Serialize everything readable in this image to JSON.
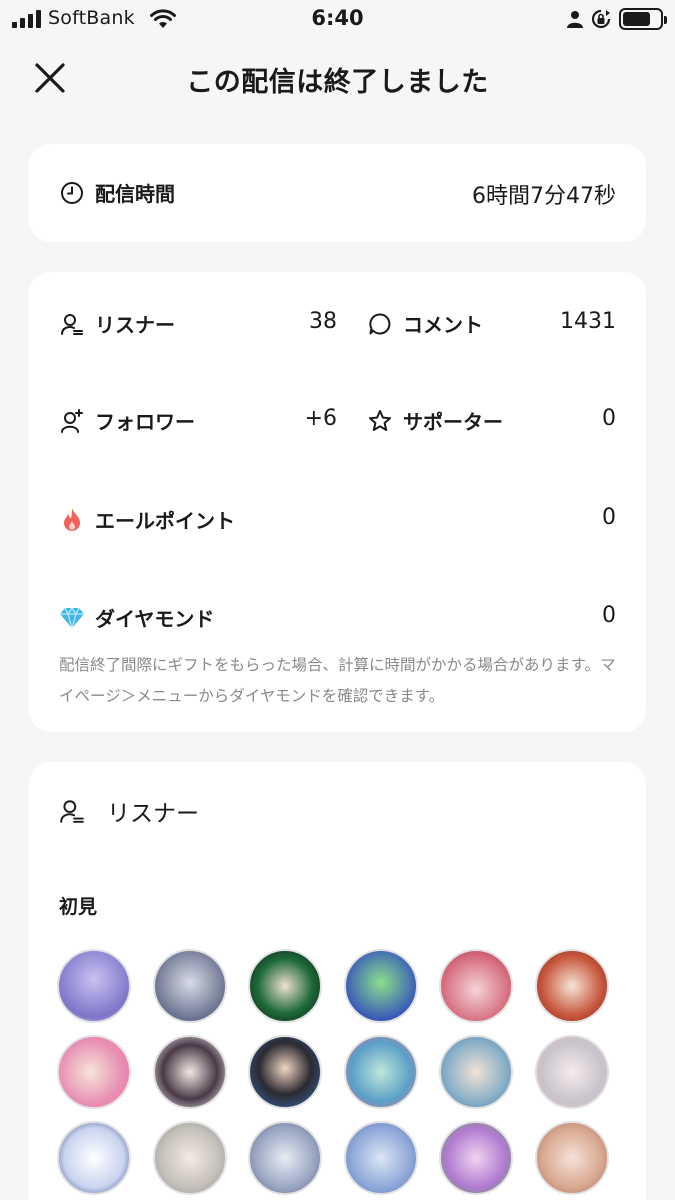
{
  "status_bar": {
    "carrier": "SoftBank",
    "time": "6:40"
  },
  "header": {
    "title": "この配信は終了しました",
    "close_icon": "close-icon"
  },
  "duration": {
    "label": "配信時間",
    "value": "6時間7分47秒",
    "icon": "clock-icon"
  },
  "stats": {
    "listeners": {
      "label": "リスナー",
      "value": "38",
      "icon": "user-list-icon"
    },
    "comments": {
      "label": "コメント",
      "value": "1431",
      "icon": "speech-bubble-icon"
    },
    "followers": {
      "label": "フォロワー",
      "value": "+6",
      "icon": "user-plus-icon"
    },
    "supporters": {
      "label": "サポーター",
      "value": "0",
      "icon": "star-icon"
    },
    "yell_points": {
      "label": "エールポイント",
      "value": "0",
      "icon": "flame-icon"
    },
    "diamonds": {
      "label": "ダイヤモンド",
      "value": "0",
      "icon": "diamond-icon"
    },
    "note": "配信終了間際にギフトをもらった場合、計算に時間がかかる場合があります。マイページ＞メニューからダイヤモンドを確認できます。"
  },
  "listener_section": {
    "title": "リスナー",
    "first_time_label": "初見",
    "icon": "user-list-icon"
  },
  "colors": {
    "background": "#f6f6f6",
    "card": "#ffffff",
    "flame": "#f2615a",
    "diamond": "#3fb6e8",
    "note_text": "#8a8a8a"
  }
}
